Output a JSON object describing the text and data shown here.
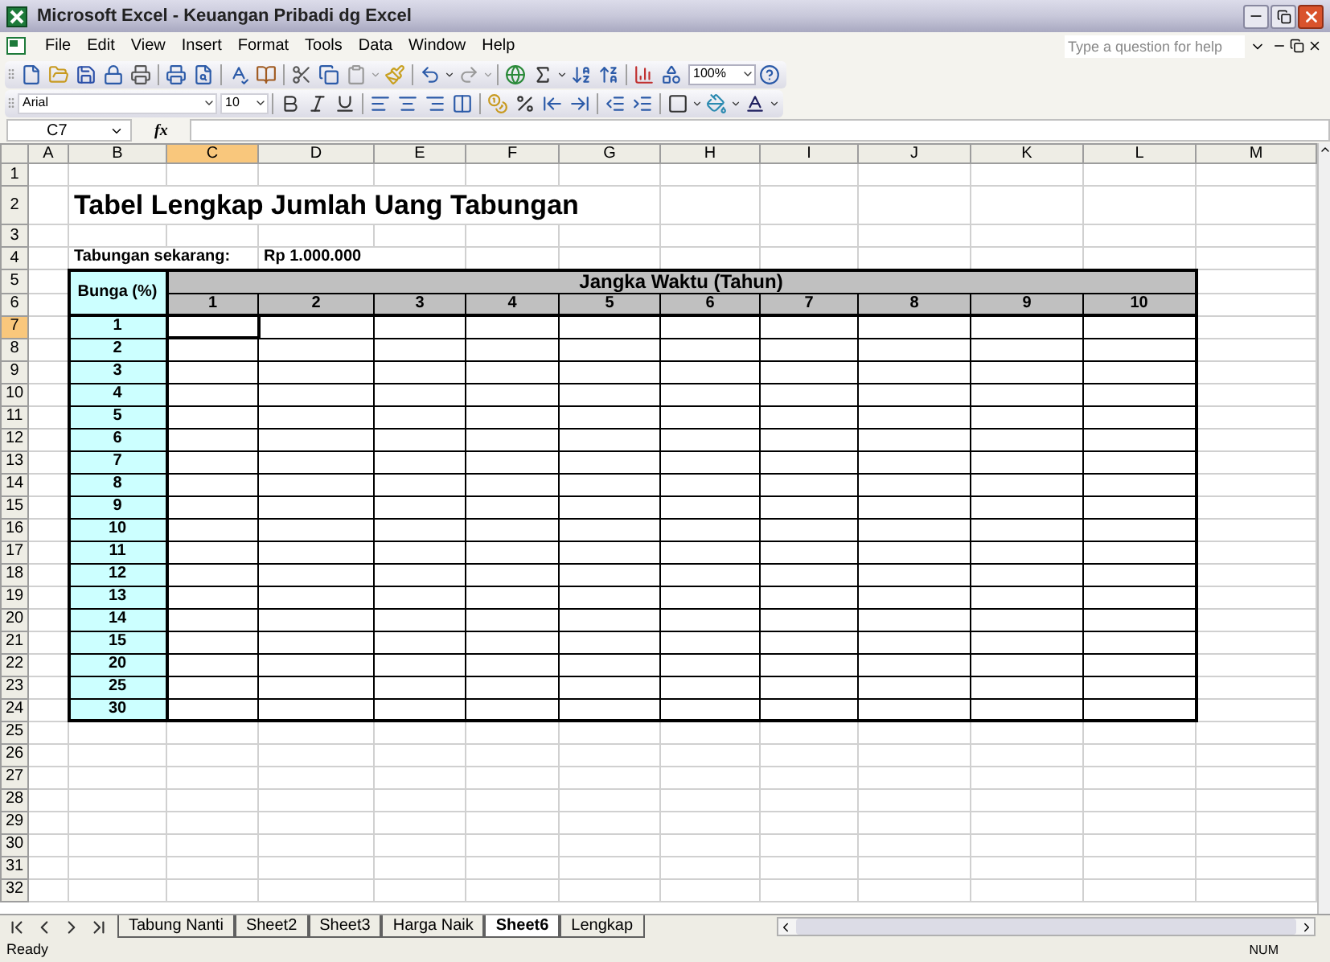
{
  "window": {
    "title": "Microsoft Excel - Keuangan Pribadi dg Excel"
  },
  "menu": [
    {
      "label": "File"
    },
    {
      "label": "Edit"
    },
    {
      "label": "View"
    },
    {
      "label": "Insert"
    },
    {
      "label": "Format"
    },
    {
      "label": "Tools"
    },
    {
      "label": "Data"
    },
    {
      "label": "Window"
    },
    {
      "label": "Help"
    }
  ],
  "help_box": {
    "placeholder": "Type a question for help"
  },
  "standard_toolbar": {
    "zoom": "100%"
  },
  "formatting_toolbar": {
    "font": "Arial",
    "size": "10"
  },
  "formula_bar": {
    "name_box": "C7",
    "function_label": "fx"
  },
  "columns": [
    {
      "label": "A",
      "selected": false
    },
    {
      "label": "B",
      "selected": false
    },
    {
      "label": "C",
      "selected": true
    },
    {
      "label": "D",
      "selected": false
    },
    {
      "label": "E",
      "selected": false
    },
    {
      "label": "F",
      "selected": false
    },
    {
      "label": "G",
      "selected": false
    },
    {
      "label": "H",
      "selected": false
    },
    {
      "label": "I",
      "selected": false
    },
    {
      "label": "J",
      "selected": false
    },
    {
      "label": "K",
      "selected": false
    },
    {
      "label": "L",
      "selected": false
    },
    {
      "label": "M",
      "selected": false
    }
  ],
  "rows": [
    {
      "label": "1",
      "selected": false
    },
    {
      "label": "2",
      "selected": false
    },
    {
      "label": "3",
      "selected": false
    },
    {
      "label": "4",
      "selected": false
    },
    {
      "label": "5",
      "selected": false
    },
    {
      "label": "6",
      "selected": false
    },
    {
      "label": "7",
      "selected": true
    },
    {
      "label": "8",
      "selected": false
    },
    {
      "label": "9",
      "selected": false
    },
    {
      "label": "10",
      "selected": false
    },
    {
      "label": "11",
      "selected": false
    },
    {
      "label": "12",
      "selected": false
    },
    {
      "label": "13",
      "selected": false
    },
    {
      "label": "14",
      "selected": false
    },
    {
      "label": "15",
      "selected": false
    },
    {
      "label": "16",
      "selected": false
    },
    {
      "label": "17",
      "selected": false
    },
    {
      "label": "18",
      "selected": false
    },
    {
      "label": "19",
      "selected": false
    },
    {
      "label": "20",
      "selected": false
    },
    {
      "label": "21",
      "selected": false
    },
    {
      "label": "22",
      "selected": false
    },
    {
      "label": "23",
      "selected": false
    },
    {
      "label": "24",
      "selected": false
    },
    {
      "label": "25",
      "selected": false
    },
    {
      "label": "26",
      "selected": false
    },
    {
      "label": "27",
      "selected": false
    },
    {
      "label": "28",
      "selected": false
    },
    {
      "label": "29",
      "selected": false
    },
    {
      "label": "30",
      "selected": false
    },
    {
      "label": "31",
      "selected": false
    },
    {
      "label": "32",
      "selected": false
    }
  ],
  "sheet": {
    "title": "Tabel Lengkap Jumlah Uang Tabungan",
    "savings_label": "Tabungan sekarang:",
    "savings_amount": "Rp 1.000.000",
    "rate_header": "Bunga (%)",
    "period_header": "Jangka Waktu (Tahun)",
    "years": [
      "1",
      "2",
      "3",
      "4",
      "5",
      "6",
      "7",
      "8",
      "9",
      "10"
    ],
    "rates": [
      "1",
      "2",
      "3",
      "4",
      "5",
      "6",
      "7",
      "8",
      "9",
      "10",
      "11",
      "12",
      "13",
      "14",
      "15",
      "20",
      "25",
      "30"
    ]
  },
  "sheet_tabs": [
    {
      "label": "Tabung Nanti",
      "selected": false
    },
    {
      "label": "Sheet2",
      "selected": false
    },
    {
      "label": "Sheet3",
      "selected": false
    },
    {
      "label": "Harga Naik",
      "selected": false
    },
    {
      "label": "Sheet6",
      "selected": true
    },
    {
      "label": "Lengkap",
      "selected": false
    }
  ],
  "status_bar": {
    "text": "Ready",
    "num": "NUM"
  }
}
